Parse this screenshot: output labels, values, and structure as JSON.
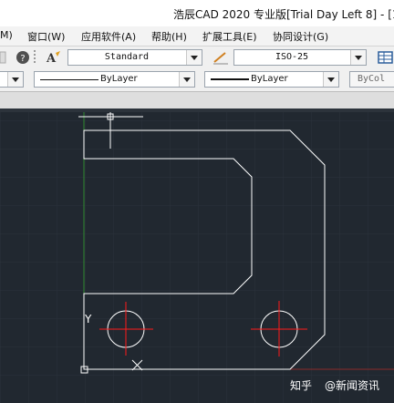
{
  "window": {
    "title": "浩辰CAD 2020 专业版[Trial Day Left 8] - [1"
  },
  "menu": {
    "items": [
      "M)",
      "窗口(W)",
      "应用软件(A)",
      "帮助(H)",
      "扩展工具(E)",
      "协同设计(G)"
    ]
  },
  "toolbar": {
    "text_style": "Standard",
    "dim_style": "ISO-25"
  },
  "properties": {
    "color": "",
    "linetype": "ByLayer",
    "lineweight": "ByLayer",
    "plotstyle": "ByCol"
  },
  "drawing": {
    "ucs_label": "Y"
  },
  "watermark": {
    "brand": "知乎",
    "handle": "@新闻资讯"
  },
  "colors": {
    "canvas_bg": "#212830",
    "grid": "#2a323b",
    "geometry": "#ffffff",
    "centerline": "#ff1a1a",
    "y_axis": "#2f8a2f",
    "x_axis": "#8a2a2a"
  }
}
